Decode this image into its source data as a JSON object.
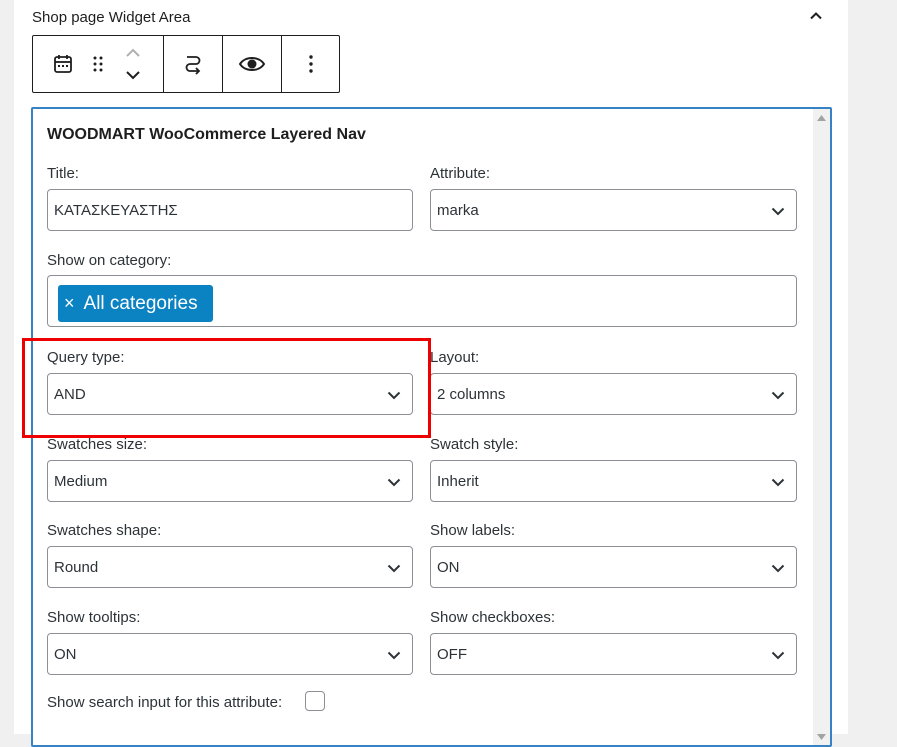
{
  "header": {
    "area_title": "Shop page Widget Area",
    "collapse_icon": "chevron-up-icon"
  },
  "toolbar": {
    "block_icon": "calendar-icon",
    "drag_icon": "drag-handle-icon",
    "move_up_icon": "chevron-up-icon",
    "move_down_icon": "chevron-down-icon",
    "transform_icon": "legacy-widget-icon",
    "preview_icon": "eye-icon",
    "more_icon": "more-vertical-icon"
  },
  "widget": {
    "title": "WOODMART WooCommerce Layered Nav",
    "fields": {
      "title": {
        "label": "Title:",
        "value": "ΚΑΤΑΣΚΕΥΑΣΤΗΣ"
      },
      "attribute": {
        "label": "Attribute:",
        "value": "marka"
      },
      "show_on_category": {
        "label": "Show on category:",
        "chip": "All categories",
        "chip_remove": "×"
      },
      "query_type": {
        "label": "Query type:",
        "value": "AND"
      },
      "layout": {
        "label": "Layout:",
        "value": "2 columns"
      },
      "swatches_size": {
        "label": "Swatches size:",
        "value": "Medium"
      },
      "swatch_style": {
        "label": "Swatch style:",
        "value": "Inherit"
      },
      "swatches_shape": {
        "label": "Swatches shape:",
        "value": "Round"
      },
      "show_labels": {
        "label": "Show labels:",
        "value": "ON"
      },
      "show_tooltips": {
        "label": "Show tooltips:",
        "value": "ON"
      },
      "show_checkboxes": {
        "label": "Show checkboxes:",
        "value": "OFF"
      },
      "show_search_input": {
        "label": "Show search input for this attribute:",
        "checked": false
      }
    }
  },
  "colors": {
    "accent": "#3582c4",
    "chip": "#0b82c2",
    "highlight": "#ef0000"
  }
}
